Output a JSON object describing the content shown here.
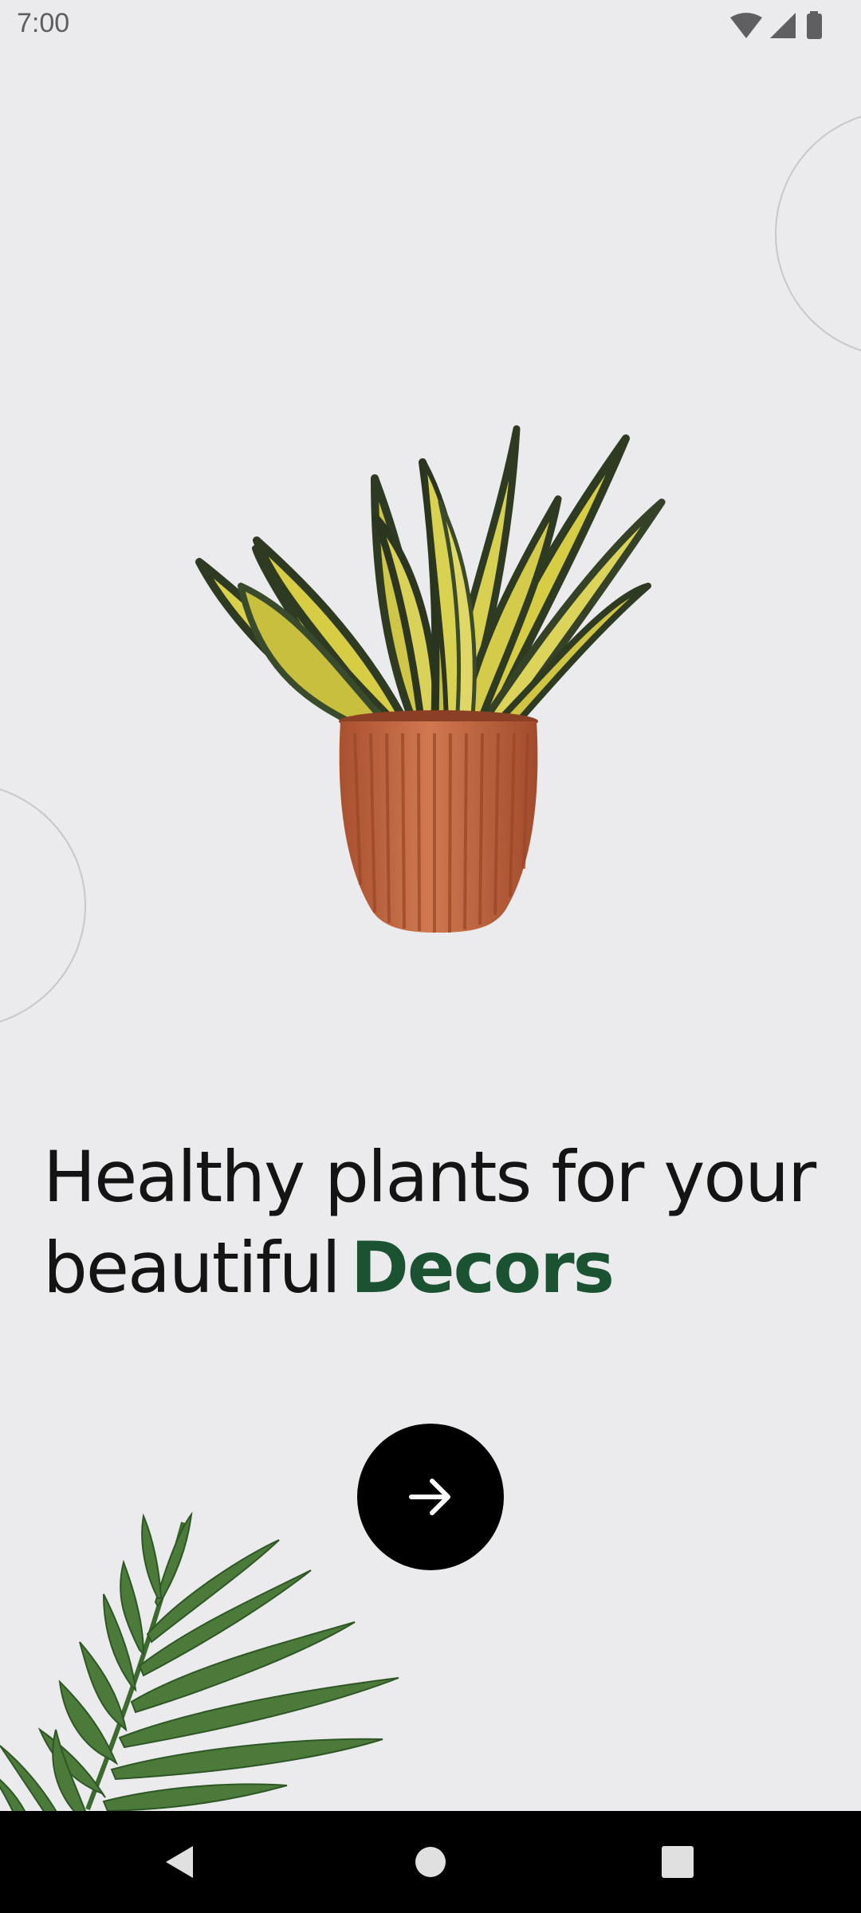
{
  "status_bar": {
    "time": "7:00",
    "icons": [
      "wifi-icon",
      "cellular-signal-icon",
      "battery-icon"
    ]
  },
  "hero": {
    "image": "potted-snake-plant",
    "decorations": [
      "fern-leaf",
      "outline-circle"
    ]
  },
  "headline": {
    "text": "Healthy plants for your beautiful",
    "accent": "Decors"
  },
  "next_button": {
    "icon": "arrow-right-icon"
  },
  "nav_bar": {
    "items": [
      "back-icon",
      "home-icon",
      "recents-icon"
    ]
  },
  "colors": {
    "background": "#ebebed",
    "accent": "#1b5232",
    "button": "#000000",
    "text": "#141414",
    "pot": "#c96a45",
    "leaf_yellow": "#d7d04a",
    "leaf_dark": "#3a4a2c"
  }
}
